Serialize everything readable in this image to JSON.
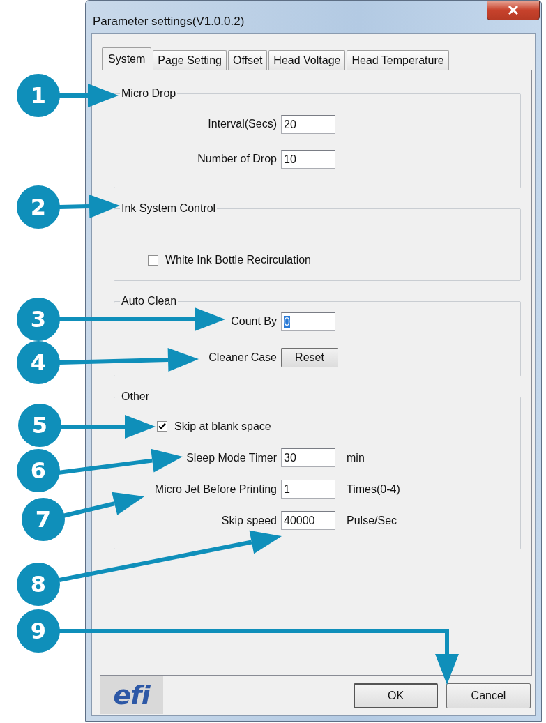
{
  "window": {
    "title": "Parameter settings(V1.0.0.2)"
  },
  "tabs": [
    {
      "label": "System",
      "selected": true
    },
    {
      "label": "Page Setting",
      "selected": false
    },
    {
      "label": "Offset",
      "selected": false
    },
    {
      "label": "Head Voltage",
      "selected": false
    },
    {
      "label": "Head Temperature",
      "selected": false
    }
  ],
  "groups": [
    {
      "title": "Micro Drop",
      "rows": [
        {
          "kind": "field",
          "label": "Interval(Secs)",
          "value": "20",
          "highlighted": false
        },
        {
          "kind": "field",
          "label": "Number of Drop",
          "value": "10",
          "highlighted": false
        }
      ]
    },
    {
      "title": "Ink System Control",
      "rows": [
        {
          "kind": "checkbox",
          "label": "White Ink Bottle Recirculation",
          "checked": false
        }
      ]
    },
    {
      "title": "Auto Clean",
      "rows": [
        {
          "kind": "field",
          "label": "Count By",
          "value": "0",
          "highlighted": true
        },
        {
          "kind": "button",
          "label": "Cleaner Case",
          "button": "Reset"
        }
      ]
    },
    {
      "title": "Other",
      "rows": [
        {
          "kind": "checkbox",
          "label": "Skip at blank space",
          "checked": true
        },
        {
          "kind": "field",
          "label": "Sleep Mode Timer",
          "value": "30",
          "unit": "min",
          "highlighted": false
        },
        {
          "kind": "field",
          "label": "Micro Jet Before Printing",
          "value": "1",
          "unit": "Times(0-4)",
          "highlighted": false
        },
        {
          "kind": "field",
          "label": "Skip speed",
          "value": "40000",
          "unit": "Pulse/Sec",
          "highlighted": false
        }
      ]
    }
  ],
  "logo": {
    "text": "efi"
  },
  "buttons": [
    {
      "label": "OK"
    },
    {
      "label": "Cancel"
    }
  ],
  "callouts": [
    {
      "number": "1"
    },
    {
      "number": "2"
    },
    {
      "number": "3"
    },
    {
      "number": "4"
    },
    {
      "number": "5"
    },
    {
      "number": "6"
    },
    {
      "number": "7"
    },
    {
      "number": "8"
    },
    {
      "number": "9"
    }
  ]
}
